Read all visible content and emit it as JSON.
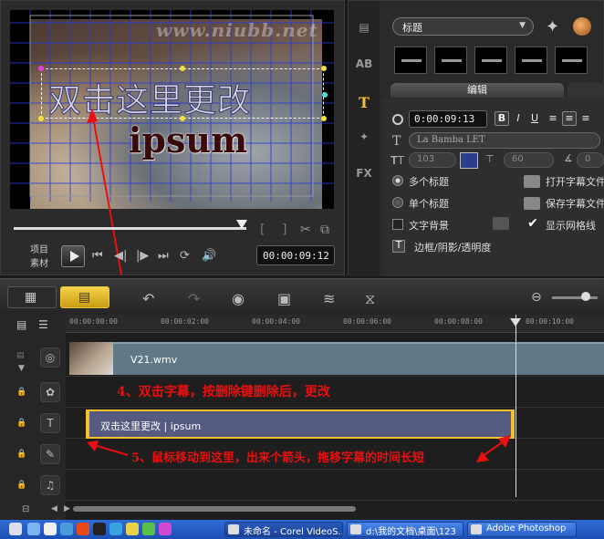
{
  "preview": {
    "watermark": "www.niubb.net",
    "title_line1": "双击这里更改",
    "title_line2": "ipsum",
    "mode_project": "项目",
    "mode_clip": "素材",
    "timecode": "00:00:09:12",
    "trim_in": "[",
    "trim_out": "]"
  },
  "options": {
    "style_dropdown": "标题",
    "edit_tab": "编辑",
    "duration": "0:00:09:13",
    "bold": "B",
    "italic": "I",
    "underline": "U",
    "font_name": "La Bamba LET",
    "font_size": "103",
    "line_spacing": "60",
    "rotation": "0",
    "radio_multi": "多个标题",
    "radio_single": "单个标题",
    "check_background": "文字背景",
    "open_title_file": "打开字幕文件",
    "save_title_file": "保存字幕文件",
    "show_grid": "显示网格线",
    "border_shadow": "边框/阴影/透明度",
    "colors": {
      "text_color": "#2c3e8a"
    }
  },
  "timeline": {
    "ruler_labels": [
      "00:00:00:00",
      "00:00:02:00",
      "00:00:04:00",
      "00:00:06:00",
      "00:00:08:00",
      "00:00:10:00"
    ],
    "video_clip_name": "V21.wmv",
    "title_clip_label": "双击这里更改 | ipsum",
    "annotation_4": "4、双击字幕，按删除键删除后，更改",
    "annotation_5": "5、鼠标移动到这里，出来个箭头，拖移字幕的时间长短"
  },
  "taskbar": {
    "task1": "未命名 - Corel VideoS...",
    "task2": "d:\\我的文档\\桌面\\123",
    "task3": "Adobe Photoshop"
  }
}
